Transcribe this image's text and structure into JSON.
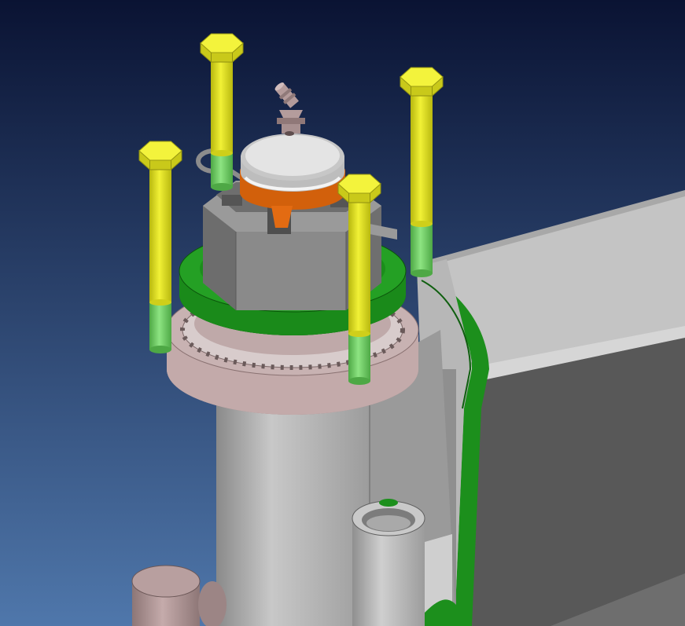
{
  "viewport": {
    "background_top": "#0a1333",
    "background_bottom": "#4f77ab"
  },
  "parts": {
    "bolt_color": "#e8e81e",
    "bolt_shank_green": "#7fd672",
    "flange_color": "#b8a3a3",
    "seal_green": "#1c8f1c",
    "nut_color": "#7f7f7f",
    "cap_color": "#cfcfcf",
    "lock_washer_orange": "#e06a10",
    "housing_gray": "#b4b4b4",
    "edge_green": "#1c8f1c"
  },
  "bolts": [
    {
      "id": "bolt-back-left"
    },
    {
      "id": "bolt-front-left"
    },
    {
      "id": "bolt-back-right"
    },
    {
      "id": "bolt-front-right"
    }
  ]
}
